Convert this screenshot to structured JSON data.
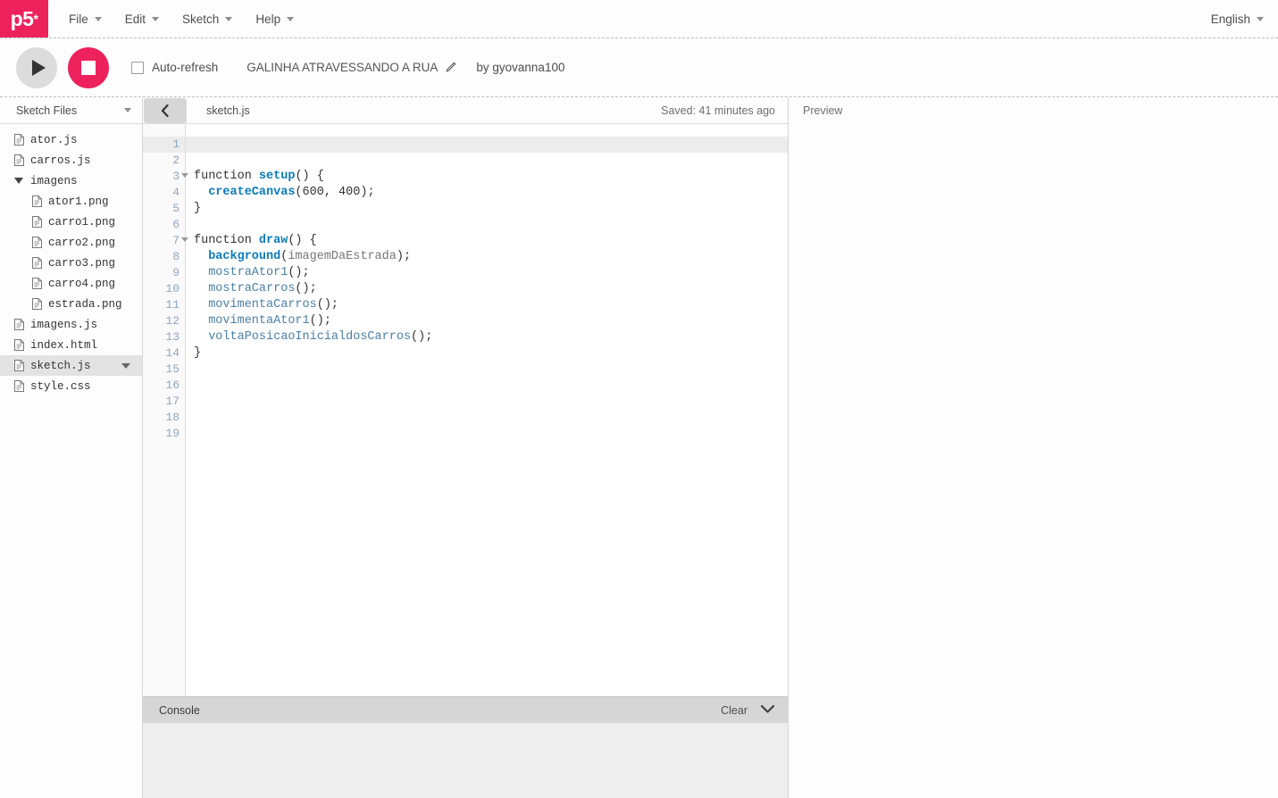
{
  "nav": {
    "logo": "p5",
    "logo_star": "*",
    "menus": [
      {
        "label": "File"
      },
      {
        "label": "Edit"
      },
      {
        "label": "Sketch"
      },
      {
        "label": "Help"
      }
    ],
    "language": "English"
  },
  "toolbar": {
    "play_icon": "play-icon",
    "stop_icon": "stop-icon",
    "auto_refresh_label": "Auto-refresh",
    "auto_refresh_checked": false,
    "sketch_title": "GALINHA ATRAVESSANDO A RUA",
    "edit_icon": "pencil-icon",
    "by_prefix": "by ",
    "author": "gyovanna100"
  },
  "sidebar": {
    "header": "Sketch Files",
    "files": [
      {
        "name": "ator.js",
        "type": "file",
        "nested": false,
        "selected": false
      },
      {
        "name": "carros.js",
        "type": "file",
        "nested": false,
        "selected": false
      },
      {
        "name": "imagens",
        "type": "folder",
        "nested": false,
        "selected": false
      },
      {
        "name": "ator1.png",
        "type": "file",
        "nested": true,
        "selected": false
      },
      {
        "name": "carro1.png",
        "type": "file",
        "nested": true,
        "selected": false
      },
      {
        "name": "carro2.png",
        "type": "file",
        "nested": true,
        "selected": false
      },
      {
        "name": "carro3.png",
        "type": "file",
        "nested": true,
        "selected": false
      },
      {
        "name": "carro4.png",
        "type": "file",
        "nested": true,
        "selected": false
      },
      {
        "name": "estrada.png",
        "type": "file",
        "nested": true,
        "selected": false
      },
      {
        "name": "imagens.js",
        "type": "file",
        "nested": false,
        "selected": false
      },
      {
        "name": "index.html",
        "type": "file",
        "nested": false,
        "selected": false
      },
      {
        "name": "sketch.js",
        "type": "file",
        "nested": false,
        "selected": true
      },
      {
        "name": "style.css",
        "type": "file",
        "nested": false,
        "selected": false
      }
    ]
  },
  "editor": {
    "collapse_icon": "chevron-left-icon",
    "filename": "sketch.js",
    "saved_status": "Saved: 41 minutes ago",
    "active_line": 1,
    "total_lines": 19,
    "fold_lines": [
      3,
      7
    ],
    "lines": [
      {
        "n": 1,
        "tokens": []
      },
      {
        "n": 2,
        "tokens": []
      },
      {
        "n": 3,
        "tokens": [
          {
            "t": "function ",
            "c": "kw"
          },
          {
            "t": "setup",
            "c": "fn"
          },
          {
            "t": "() {",
            "c": "punc"
          }
        ]
      },
      {
        "n": 4,
        "tokens": [
          {
            "t": "  ",
            "c": "punc"
          },
          {
            "t": "createCanvas",
            "c": "fn"
          },
          {
            "t": "(",
            "c": "punc"
          },
          {
            "t": "600",
            "c": "num"
          },
          {
            "t": ", ",
            "c": "punc"
          },
          {
            "t": "400",
            "c": "num"
          },
          {
            "t": ");",
            "c": "punc"
          }
        ]
      },
      {
        "n": 5,
        "tokens": [
          {
            "t": "}",
            "c": "punc"
          }
        ]
      },
      {
        "n": 6,
        "tokens": []
      },
      {
        "n": 7,
        "tokens": [
          {
            "t": "function ",
            "c": "kw"
          },
          {
            "t": "draw",
            "c": "fn"
          },
          {
            "t": "() {",
            "c": "punc"
          }
        ]
      },
      {
        "n": 8,
        "tokens": [
          {
            "t": "  ",
            "c": "punc"
          },
          {
            "t": "background",
            "c": "fn"
          },
          {
            "t": "(",
            "c": "punc"
          },
          {
            "t": "imagemDaEstrada",
            "c": "id"
          },
          {
            "t": ");",
            "c": "punc"
          }
        ]
      },
      {
        "n": 9,
        "tokens": [
          {
            "t": "  ",
            "c": "punc"
          },
          {
            "t": "mostraAtor1",
            "c": "call"
          },
          {
            "t": "();",
            "c": "punc"
          }
        ]
      },
      {
        "n": 10,
        "tokens": [
          {
            "t": "  ",
            "c": "punc"
          },
          {
            "t": "mostraCarros",
            "c": "call"
          },
          {
            "t": "();",
            "c": "punc"
          }
        ]
      },
      {
        "n": 11,
        "tokens": [
          {
            "t": "  ",
            "c": "punc"
          },
          {
            "t": "movimentaCarros",
            "c": "call"
          },
          {
            "t": "();",
            "c": "punc"
          }
        ]
      },
      {
        "n": 12,
        "tokens": [
          {
            "t": "  ",
            "c": "punc"
          },
          {
            "t": "movimentaAtor1",
            "c": "call"
          },
          {
            "t": "();",
            "c": "punc"
          }
        ]
      },
      {
        "n": 13,
        "tokens": [
          {
            "t": "  ",
            "c": "punc"
          },
          {
            "t": "voltaPosicaoInicialdosCarros",
            "c": "call"
          },
          {
            "t": "();",
            "c": "punc"
          }
        ]
      },
      {
        "n": 14,
        "tokens": [
          {
            "t": "}",
            "c": "punc"
          }
        ]
      },
      {
        "n": 15,
        "tokens": []
      },
      {
        "n": 16,
        "tokens": []
      },
      {
        "n": 17,
        "tokens": []
      },
      {
        "n": 18,
        "tokens": []
      },
      {
        "n": 19,
        "tokens": []
      }
    ]
  },
  "console": {
    "title": "Console",
    "clear_label": "Clear",
    "collapse_icon": "chevron-down-icon",
    "messages": []
  },
  "preview": {
    "label": "Preview"
  },
  "colors": {
    "brand_pink": "#ed225d",
    "p5_blue": "#0b7cbb",
    "call_blue": "#4a7fa5",
    "identifier_gray": "#777777",
    "line_number": "#8fa6bd",
    "active_line_bg": "#ececec",
    "console_bar_bg": "#d6d6d6",
    "console_body_bg": "#eeeeee",
    "play_button_bg": "#dcdcdc"
  }
}
